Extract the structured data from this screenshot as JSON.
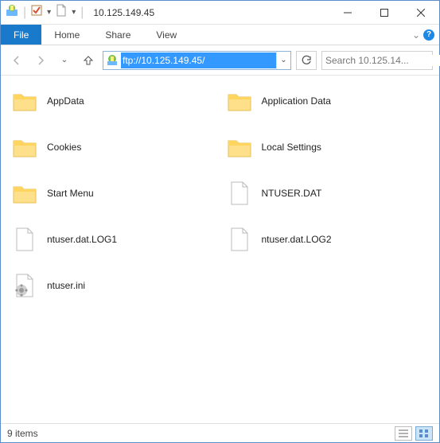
{
  "window": {
    "title": "10.125.149.45"
  },
  "ribbon": {
    "file": "File",
    "tabs": [
      "Home",
      "Share",
      "View"
    ]
  },
  "address": {
    "value": "ftp://10.125.149.45/"
  },
  "search": {
    "placeholder": "Search 10.125.14..."
  },
  "items": [
    {
      "name": "AppData",
      "type": "folder"
    },
    {
      "name": "Application Data",
      "type": "folder"
    },
    {
      "name": "Cookies",
      "type": "folder"
    },
    {
      "name": "Local Settings",
      "type": "folder"
    },
    {
      "name": "Start Menu",
      "type": "folder"
    },
    {
      "name": "NTUSER.DAT",
      "type": "file"
    },
    {
      "name": "ntuser.dat.LOG1",
      "type": "file"
    },
    {
      "name": "ntuser.dat.LOG2",
      "type": "file"
    },
    {
      "name": "ntuser.ini",
      "type": "ini"
    }
  ],
  "status": {
    "count": "9 items"
  }
}
